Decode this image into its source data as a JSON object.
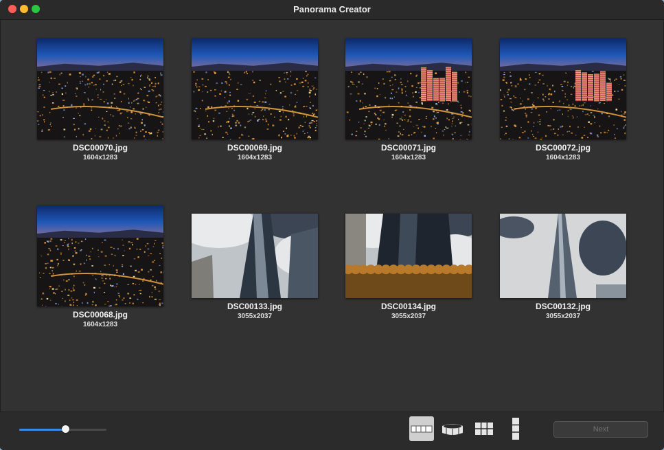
{
  "window": {
    "title": "Panorama Creator"
  },
  "images": [
    {
      "filename": "DSC00070.jpg",
      "dimensions": "1604x1283",
      "scene": "night-city"
    },
    {
      "filename": "DSC00069.jpg",
      "dimensions": "1604x1283",
      "scene": "night-city"
    },
    {
      "filename": "DSC00071.jpg",
      "dimensions": "1604x1283",
      "scene": "night-city"
    },
    {
      "filename": "DSC00072.jpg",
      "dimensions": "1604x1283",
      "scene": "night-city"
    },
    {
      "filename": "DSC00068.jpg",
      "dimensions": "1604x1283",
      "scene": "night-city"
    },
    {
      "filename": "DSC00133.jpg",
      "dimensions": "3055x2037",
      "scene": "skyscraper"
    },
    {
      "filename": "DSC00134.jpg",
      "dimensions": "3055x2037",
      "scene": "skyscraper-trees"
    },
    {
      "filename": "DSC00132.jpg",
      "dimensions": "3055x2037",
      "scene": "skyscraper-clouds"
    }
  ],
  "toolbar": {
    "zoom_level": 0.53,
    "modes": [
      {
        "name": "horizontal-panorama",
        "active": true
      },
      {
        "name": "360-panorama",
        "active": false
      },
      {
        "name": "grid-panorama",
        "active": false
      },
      {
        "name": "vertical-panorama",
        "active": false
      }
    ],
    "next_label": "Next"
  },
  "colors": {
    "accent": "#3b88e8",
    "window_bg": "#323232"
  }
}
